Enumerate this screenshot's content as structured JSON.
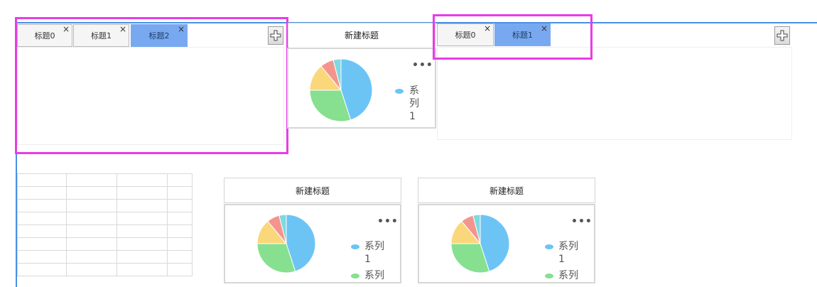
{
  "top_left_tabs": {
    "tabs": [
      {
        "label": "标题0",
        "active": false
      },
      {
        "label": "标题1",
        "active": false
      },
      {
        "label": "标题2",
        "active": true
      }
    ],
    "close_glyph": "×",
    "add_icon": "plus-icon"
  },
  "top_mid_chart": {
    "title": "新建标题",
    "menu_glyph": "•••",
    "legend": [
      "系列1"
    ]
  },
  "top_right_tabs": {
    "tabs": [
      {
        "label": "标题0",
        "active": false
      },
      {
        "label": "标题1",
        "active": true
      }
    ],
    "close_glyph": "×",
    "add_icon": "plus-icon"
  },
  "bottom_chart_1": {
    "title": "新建标题",
    "menu_glyph": "•••",
    "legend": [
      "系列1",
      "系列"
    ]
  },
  "bottom_chart_2": {
    "title": "新建标题",
    "menu_glyph": "•••",
    "legend": [
      "系列1",
      "系列"
    ]
  },
  "colors": {
    "accent": "#4a90e2",
    "active_tab": "#78a9f0",
    "highlight": "#e83ce6",
    "slice_blue": "#6cc4f5",
    "slice_green": "#86e08f",
    "slice_yellow": "#fbd77c",
    "slice_red": "#f4958d",
    "slice_teal": "#7fd9df"
  },
  "chart_data": [
    {
      "type": "pie",
      "title": "新建标题",
      "series": [
        {
          "name": "系列1",
          "values": [
            45,
            30,
            14,
            7,
            4
          ]
        }
      ]
    },
    {
      "type": "pie",
      "title": "新建标题",
      "series": [
        {
          "name": "系列1",
          "values": [
            45,
            30,
            14,
            7,
            4
          ]
        }
      ]
    },
    {
      "type": "pie",
      "title": "新建标题",
      "series": [
        {
          "name": "系列1",
          "values": [
            45,
            30,
            14,
            7,
            4
          ]
        }
      ]
    }
  ]
}
